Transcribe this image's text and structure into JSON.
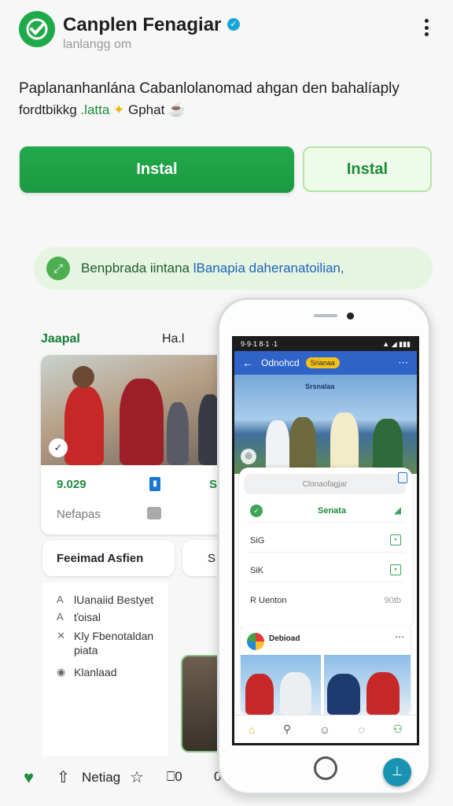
{
  "header": {
    "title": "Canplen Fenagiar",
    "subtitle": "lanlangg om",
    "verified_icon": "verified-check-icon",
    "menu_icon": "more-vert-icon"
  },
  "description": {
    "line1": "Paplananhanlána Cabanlolanomad ahgan den  bahalíaply",
    "line2_prefix": "fordtbikkg ",
    "line2_highlight": ".latta",
    "line2_star": "✦",
    "line2_suffix": " Gphat",
    "line2_emoji": "☕"
  },
  "buttons": {
    "install_primary": "Instal",
    "install_secondary": "Instal"
  },
  "banner": {
    "prefix": "Benpbrada iintana ",
    "link": "lBanapia daheranatoilian,"
  },
  "left": {
    "col_header1": "Jaapal",
    "col_header2": "Ha.l",
    "card_value": "9.029",
    "card_value2": "S",
    "card_label": "Nefapas",
    "pill_a": "Feeimad Asfien",
    "pill_b": "S",
    "list": [
      {
        "icon": "A",
        "text": "lUanaiid Bestyet"
      },
      {
        "icon": "A",
        "text": "ťoisal"
      },
      {
        "icon": "✕",
        "text": "Kly Fbenotaldan"
      },
      {
        "icon": "",
        "text": "piata"
      },
      {
        "icon": "◉",
        "text": "Klanlaad"
      }
    ]
  },
  "bottom_bar": {
    "label": "Netiag",
    "count1": "0",
    "count2": "0"
  },
  "phone": {
    "status_time": "9·9·1 8·1 ·1",
    "status_right": "▲ ◢ ▮▮▮",
    "top_title": "Odnohcd",
    "top_tag": "Srianaa",
    "hero_caption": "Srsnalaa",
    "search_placeholder": "Clonaofagjar",
    "row_center": "Senata",
    "row1": "SiG",
    "row2": "SiK",
    "row3_left": "R  Uenton",
    "row3_right": "90tb",
    "post_name": "Debioad",
    "nav_icons": [
      "home-icon",
      "search-icon",
      "ghost-icon",
      "chat-icon",
      "profile-icon"
    ]
  },
  "colors": {
    "brand_green": "#1faa4a",
    "accent_blue": "#2f63c8",
    "fab": "#1a93b3"
  }
}
